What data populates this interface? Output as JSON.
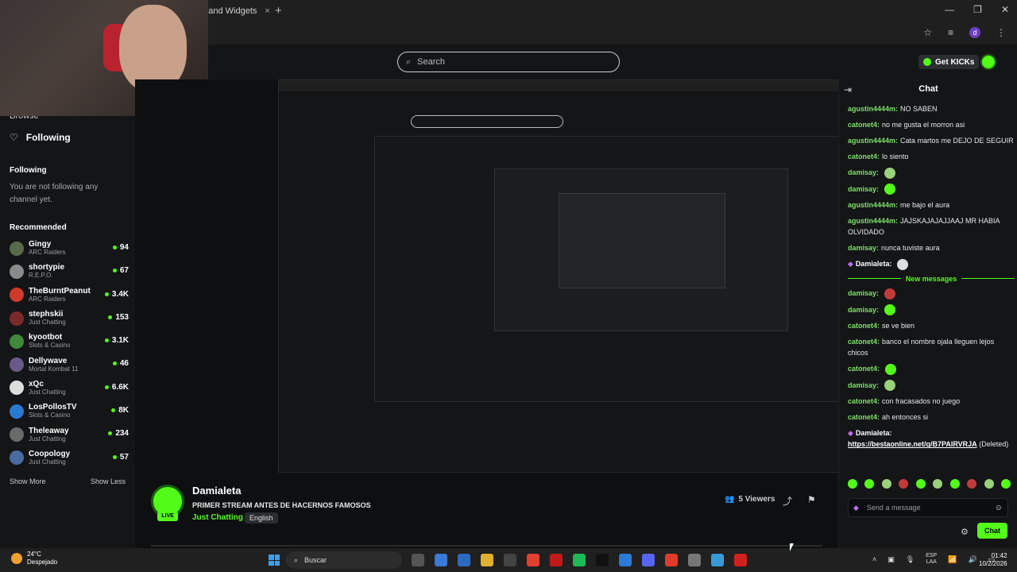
{
  "browser": {
    "tab_title": "ot and Widgets",
    "tab_close": "×",
    "new_tab": "+",
    "win_min": "—",
    "win_max": "❐",
    "win_close": "✕",
    "star": "☆",
    "profile_initial": "d"
  },
  "topnav": {
    "search_placeholder": "Search",
    "get_kicks_label": "Get KICKs"
  },
  "sidebar": {
    "browse_label": "Browse",
    "following_nav_label": "Following",
    "following_heading": "Following",
    "not_following_text": "You are not following any channel yet.",
    "recommended_heading": "Recommended",
    "channels": [
      {
        "name": "Gingy",
        "category": "ARC Raiders",
        "viewers": "94",
        "color": "#5a6b4a"
      },
      {
        "name": "shortypie",
        "category": "R.E.P.O.",
        "viewers": "67",
        "color": "#8a8a8a"
      },
      {
        "name": "TheBurntPeanut",
        "category": "ARC Raiders",
        "viewers": "3.4K",
        "color": "#d03a2a"
      },
      {
        "name": "stephskii",
        "category": "Just Chatting",
        "viewers": "153",
        "color": "#7a2a2a"
      },
      {
        "name": "kyootbot",
        "category": "Slots & Casino",
        "viewers": "3.1K",
        "color": "#3f8a3a"
      },
      {
        "name": "Dellywave",
        "category": "Mortal Kombat 11",
        "viewers": "46",
        "color": "#6a5a8a"
      },
      {
        "name": "xQc",
        "category": "Just Chatting",
        "viewers": "6.6K",
        "color": "#dddddd"
      },
      {
        "name": "LosPollosTV",
        "category": "Slots & Casino",
        "viewers": "8K",
        "color": "#2a7ad0"
      },
      {
        "name": "Theleaway",
        "category": "Just Chatting",
        "viewers": "234",
        "color": "#6a6a6a"
      },
      {
        "name": "Coopology",
        "category": "Just Chatting",
        "viewers": "57",
        "color": "#4a6aa0"
      }
    ],
    "show_more": "Show More",
    "show_less": "Show Less"
  },
  "stream": {
    "streamer": "Damialeta",
    "title": "PRIMER STREAM ANTES DE HACERNOS FAMOSOS",
    "category": "Just Chatting",
    "language": "English",
    "live_badge": "LIVE",
    "viewers": "5 Viewers"
  },
  "chat": {
    "title": "Chat",
    "messages": [
      {
        "user": "agustin4444m:",
        "text": "NO SABEN",
        "color": "#7ee06a"
      },
      {
        "user": "catonet4:",
        "text": "no me gusta el morron asi",
        "color": "#7ee06a"
      },
      {
        "user": "agustin4444m:",
        "text": "Cata martos me DEJO DE SEGUIR",
        "color": "#7ee06a"
      },
      {
        "user": "catonet4:",
        "text": "lo siento",
        "color": "#7ee06a"
      },
      {
        "user": "damisay:",
        "text": "",
        "emote": "#9ad17a",
        "color": "#7ee06a"
      },
      {
        "user": "damisay:",
        "text": "",
        "emote": "#53fc18",
        "color": "#7ee06a"
      },
      {
        "user": "agustin4444m:",
        "text": "me bajo el aura",
        "color": "#7ee06a"
      },
      {
        "user": "agustin4444m:",
        "text": "JAJSKAJAJAJJAAJ MR HABIA OLVIDADO",
        "color": "#7ee06a"
      },
      {
        "user": "damisay:",
        "text": "nunca tuviste aura",
        "color": "#7ee06a"
      },
      {
        "user": "Damialeta:",
        "text": "",
        "emote": "#dddddd",
        "color": "#ffffff",
        "badge": true
      }
    ],
    "new_messages_label": "New messages",
    "messages_after": [
      {
        "user": "damisay:",
        "text": "",
        "emote": "#c23b3b",
        "color": "#7ee06a"
      },
      {
        "user": "damisay:",
        "text": "",
        "emote": "#53fc18",
        "color": "#7ee06a"
      },
      {
        "user": "catonet4:",
        "text": "se ve bien",
        "color": "#7ee06a"
      },
      {
        "user": "catonet4:",
        "text": "banco el nombre ojala lleguen lejos chicos",
        "color": "#7ee06a"
      },
      {
        "user": "catonet4:",
        "text": "",
        "emote": "#53fc18",
        "color": "#7ee06a"
      },
      {
        "user": "damisay:",
        "text": "",
        "emote": "#9ad17a",
        "color": "#7ee06a"
      },
      {
        "user": "catonet4:",
        "text": "con fracasados no juego",
        "color": "#7ee06a"
      },
      {
        "user": "catonet4:",
        "text": "ah entonces si",
        "color": "#7ee06a"
      }
    ],
    "deleted_msg": {
      "user": "Damialeta:",
      "link": "https://bestaonline.net/g/B7PAIRVRJA",
      "suffix": "(Deleted)"
    },
    "input_placeholder": "Send a message",
    "chat_button": "Chat"
  },
  "taskbar": {
    "temperature": "24°C",
    "weather": "Despejado",
    "search_label": "Buscar",
    "lang_top": "ESP",
    "lang_bottom": "LAA",
    "time": "01:42",
    "date": "10/2/2026"
  }
}
